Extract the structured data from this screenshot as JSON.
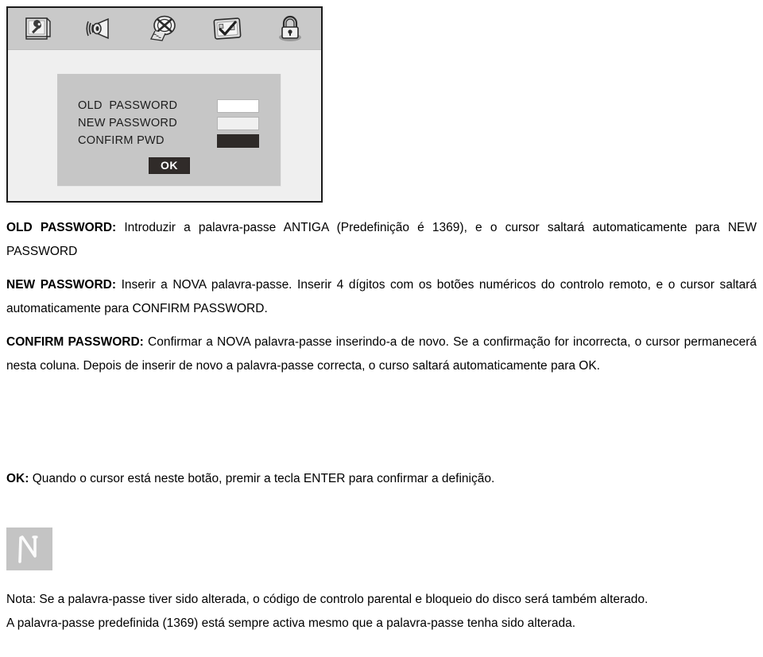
{
  "figure": {
    "caption": "OSD password setup screen",
    "toolbar": {
      "icons": [
        {
          "name": "monitor-wrench-icon",
          "label": "General Setup"
        },
        {
          "name": "speaker-icon",
          "label": "Audio Setup"
        },
        {
          "name": "film-reel-icon",
          "label": "Video Setup"
        },
        {
          "name": "preference-checkmark-icon",
          "label": "Preference Page"
        },
        {
          "name": "padlock-icon",
          "label": "Password Setup"
        }
      ]
    },
    "dialog": {
      "rows": [
        {
          "label": "OLD  PASSWORD",
          "field": "old",
          "value": ""
        },
        {
          "label": "NEW PASSWORD",
          "field": "new",
          "value": ""
        },
        {
          "label": "CONFIRM PWD",
          "field": "confirm",
          "value": ""
        }
      ],
      "ok_label": "OK"
    },
    "colors": {
      "toolbar_bg": "#c9c9c9",
      "panel_bg": "#efefef",
      "dialog_bg": "#c6c6c6",
      "old_field_bg": "#ffffff",
      "new_field_bg": "#f0f0f0",
      "confirm_field_bg": "#2e2a28",
      "ok_button_bg": "#302b29",
      "ok_button_fg": "#ffffff",
      "frame_border": "#1a1a1a"
    }
  },
  "prose": {
    "old_password": {
      "term": "OLD PASSWORD:",
      "text": " Introduzir a palavra-passe ANTIGA (Predefinição é 1369), e o cursor saltará automaticamente para NEW PASSWORD"
    },
    "new_password": {
      "term": "NEW PASSWORD:",
      "text": " Inserir a NOVA palavra-passe. Inserir 4 dígitos com os botões numéricos do controlo remoto, e o cursor saltará automaticamente para CONFIRM PASSWORD."
    },
    "confirm_password": {
      "term": "CONFIRM PASSWORD:",
      "text": " Confirmar a NOVA palavra-passe inserindo-a de novo. Se a confirmação for incorrecta, o cursor permanecerá nesta coluna. Depois de inserir de novo a palavra-passe correcta, o curso saltará automaticamente para OK."
    },
    "ok": {
      "term": "OK:",
      "text": " Quando o cursor está neste botão, premir a tecla ENTER para confirmar a definição."
    }
  },
  "note": {
    "badge_icon": "note-glyph-icon",
    "line1": "Nota: Se a palavra-passe tiver sido alterada, o código de controlo parental e bloqueio do disco será também alterado.",
    "line2": "A palavra-passe predefinida (1369) está sempre activa mesmo que a palavra-passe tenha sido alterada."
  }
}
